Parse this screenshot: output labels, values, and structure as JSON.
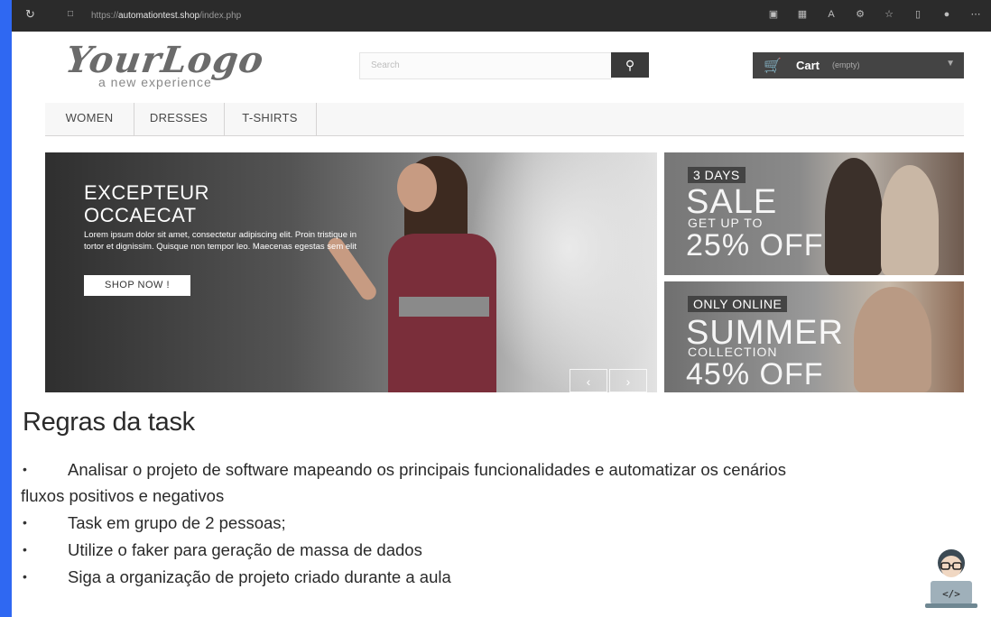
{
  "browser": {
    "url_prefix": "https://",
    "url_host": "automationtest.shop",
    "url_path": "/index.php"
  },
  "site": {
    "logo_main": "YourLogo",
    "logo_tagline": "a new experience",
    "search_placeholder": "Search",
    "cart_label": "Cart",
    "cart_status": "(empty)",
    "menu": [
      "WOMEN",
      "DRESSES",
      "T-SHIRTS"
    ],
    "hero": {
      "title_line1": "EXCEPTEUR",
      "title_line2": "OCCAECAT",
      "text": "Lorem ipsum dolor sit amet, consectetur adipiscing elit. Proin tristique in tortor et dignissim. Quisque non tempor leo. Maecenas egestas sem elit",
      "button": "SHOP NOW !"
    },
    "banner1": {
      "tag": "3 DAYS",
      "big": "SALE",
      "mid": "GET UP TO",
      "pct": "25% OFF"
    },
    "banner2": {
      "tag": "ONLY ONLINE",
      "big": "SUMMER",
      "mid": "COLLECTION",
      "pct": "45% OFF"
    }
  },
  "slide": {
    "heading": "Regras da task",
    "bullet_1_line1": "Analisar o projeto de software mapeando os principais funcionalidades e automatizar os cenários",
    "bullet_1_line2": "fluxos positivos e negativos",
    "bullet_2": "Task em grupo de 2 pessoas;",
    "bullet_3": "Utilize o faker para geração de massa de dados",
    "bullet_4": "Siga a organização de projeto criado durante a aula"
  },
  "colors": {
    "frame_blue": "#2f68f2",
    "hero_dress": "#7a2e3a",
    "cart_bg": "#444444"
  }
}
